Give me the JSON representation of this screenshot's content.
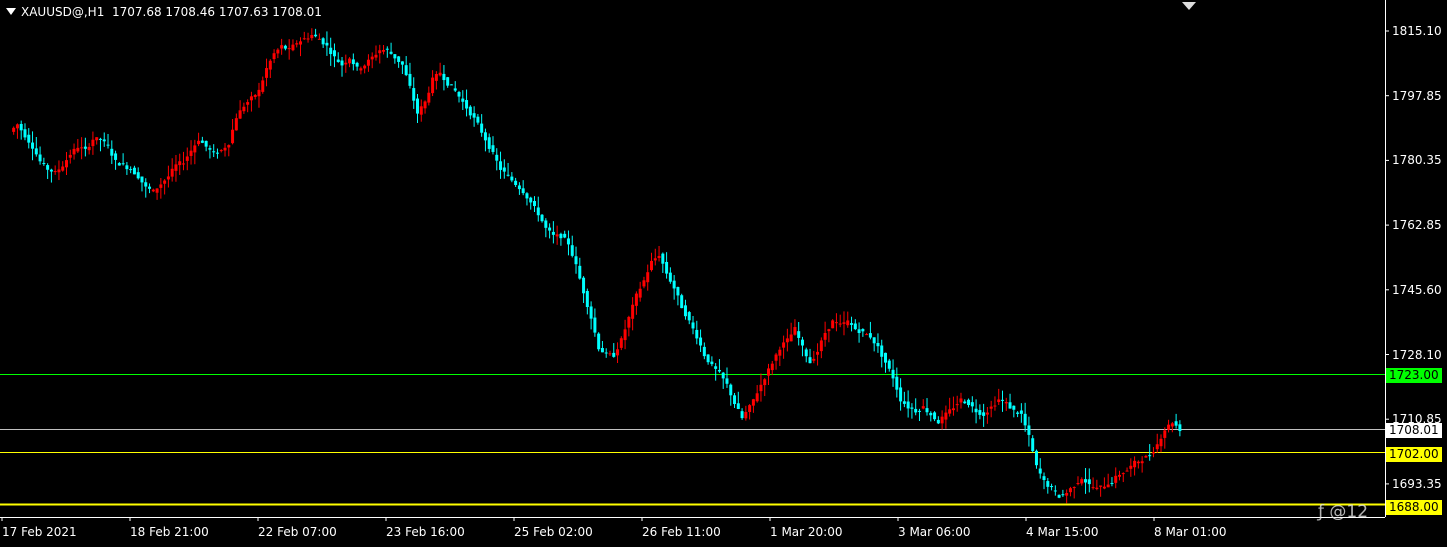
{
  "header": {
    "symbol": "XAUUSD@,H1",
    "ohlc": "1707.68 1708.46 1707.63 1708.01"
  },
  "watermark": "@12",
  "colors": {
    "background": "#000000",
    "bull": "#ff0000",
    "bear": "#00ffff",
    "axis": "#ffffff",
    "green_line": "#00ff00",
    "yellow_line": "#ffff00",
    "price_line": "#c0c0c0"
  },
  "chart_data": {
    "type": "candlestick",
    "title": "",
    "y_ticks": [
      "1815.10",
      "1797.85",
      "1780.35",
      "1762.85",
      "1745.60",
      "1728.10",
      "1710.85",
      "1693.35"
    ],
    "ylim": [
      1686,
      1820
    ],
    "x_ticks": [
      "17 Feb 2021",
      "18 Feb 21:00",
      "22 Feb 07:00",
      "23 Feb 16:00",
      "25 Feb 02:00",
      "26 Feb 11:00",
      "1 Mar 20:00",
      "3 Mar 06:00",
      "4 Mar 15:00",
      "8 Mar 01:00"
    ],
    "levels": [
      {
        "price": 1723.0,
        "label": "1723.00",
        "color": "#00ff00"
      },
      {
        "price": 1708.01,
        "label": "1708.01",
        "color": "#ffffff"
      },
      {
        "price": 1702.0,
        "label": "1702.00",
        "color": "#ffff00"
      },
      {
        "price": 1688.0,
        "label": "1688.00",
        "color": "#ffff00"
      }
    ],
    "close_path": [
      1788,
      1790,
      1787,
      1784,
      1780,
      1778,
      1777,
      1779,
      1782,
      1784,
      1783,
      1786,
      1786,
      1784,
      1780,
      1779,
      1778,
      1776,
      1773,
      1772,
      1774,
      1776,
      1779,
      1780,
      1783,
      1786,
      1784,
      1782,
      1783,
      1785,
      1792,
      1795,
      1797,
      1799,
      1805,
      1809,
      1811,
      1810,
      1812,
      1813,
      1814,
      1813,
      1811,
      1808,
      1806,
      1808,
      1805,
      1806,
      1808,
      1810,
      1810,
      1808,
      1806,
      1800,
      1793,
      1796,
      1802,
      1804,
      1801,
      1799,
      1796,
      1793,
      1790,
      1786,
      1782,
      1778,
      1776,
      1774,
      1772,
      1769,
      1766,
      1762,
      1760,
      1760,
      1758,
      1752,
      1745,
      1738,
      1730,
      1728,
      1728,
      1732,
      1738,
      1744,
      1748,
      1753,
      1755,
      1750,
      1746,
      1741,
      1737,
      1733,
      1728,
      1725,
      1723,
      1720,
      1715,
      1711,
      1714,
      1718,
      1722,
      1726,
      1730,
      1732,
      1735,
      1730,
      1726,
      1729,
      1734,
      1737,
      1736,
      1737,
      1735,
      1734,
      1733,
      1730,
      1726,
      1722,
      1716,
      1714,
      1713,
      1714,
      1712,
      1710,
      1712,
      1714,
      1716,
      1715,
      1713,
      1712,
      1714,
      1716,
      1715,
      1713,
      1712,
      1706,
      1698,
      1694,
      1692,
      1690,
      1691,
      1693,
      1695,
      1693,
      1692,
      1693,
      1694,
      1696,
      1697,
      1699,
      1700,
      1701,
      1704,
      1708,
      1710,
      1708
    ]
  }
}
